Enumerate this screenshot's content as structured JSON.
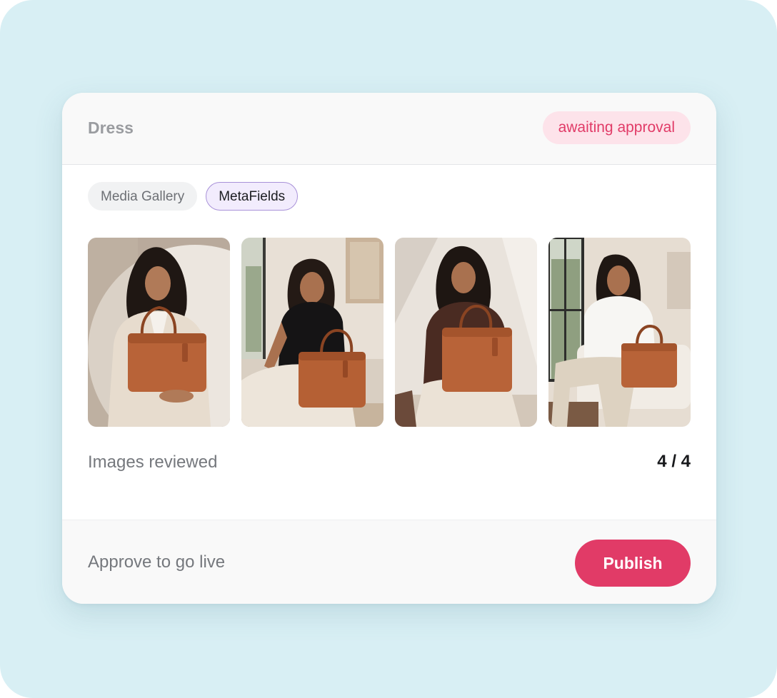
{
  "card": {
    "title": "Dress",
    "status": "awaiting approval"
  },
  "tabs": [
    {
      "label": "Media Gallery",
      "active": false
    },
    {
      "label": "MetaFields",
      "active": true
    }
  ],
  "gallery": {
    "images": [
      {
        "alt": "Woman in beige blazer holding brown leather tote bag"
      },
      {
        "alt": "Woman in black vest seated with brown leather tote bag"
      },
      {
        "alt": "Woman in brown shirt seated holding brown leather tote bag"
      },
      {
        "alt": "Woman in white shirt seated on sofa with brown leather tote bag"
      }
    ]
  },
  "review": {
    "label": "Images reviewed",
    "count": "4 / 4"
  },
  "footer": {
    "text": "Approve to go live",
    "publish_label": "Publish"
  },
  "colors": {
    "background": "#d8eff4",
    "accent": "#e13b67",
    "badge_bg": "#fde3ea",
    "active_tab_bg": "#f2ecfd",
    "active_tab_border": "#a891d8"
  }
}
